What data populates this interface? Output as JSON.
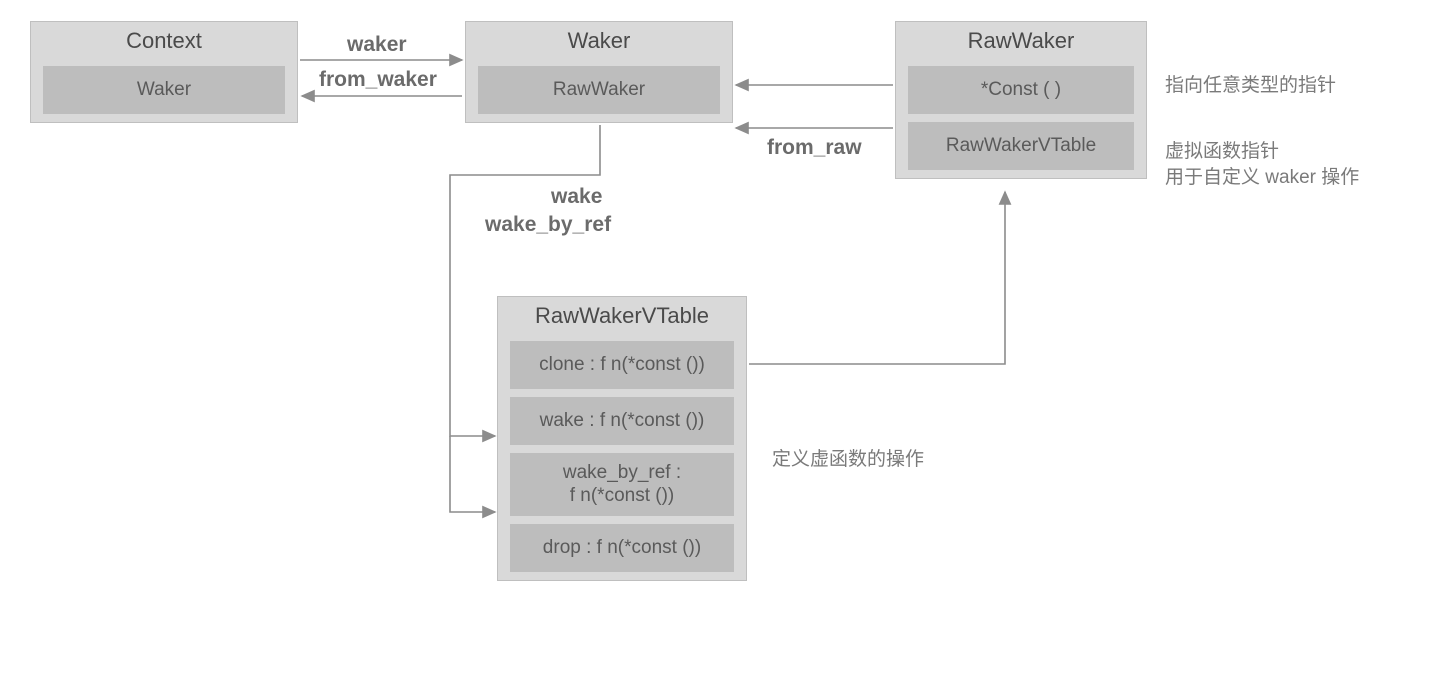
{
  "boxes": {
    "context": {
      "title": "Context",
      "fields": [
        "Waker"
      ]
    },
    "waker": {
      "title": "Waker",
      "fields": [
        "RawWaker"
      ]
    },
    "rawwaker": {
      "title": "RawWaker",
      "fields": [
        "*Const ( )",
        "RawWakerVTable"
      ]
    },
    "vtable": {
      "title": "RawWakerVTable",
      "fields": [
        "clone : f n(*const ())",
        "wake : f n(*const ())",
        "wake_by_ref : f n(*const ())",
        "drop : f n(*const ())"
      ]
    }
  },
  "labels": {
    "waker_arrow": "waker",
    "from_waker": "from_waker",
    "from_raw": "from_raw",
    "wake": "wake",
    "wake_by_ref": "wake_by_ref"
  },
  "annotations": {
    "ptr": "指向任意类型的指针",
    "vfn1": "虚拟函数指针",
    "vfn2": "用于自定义 waker 操作",
    "def": "定义虚函数的操作"
  }
}
